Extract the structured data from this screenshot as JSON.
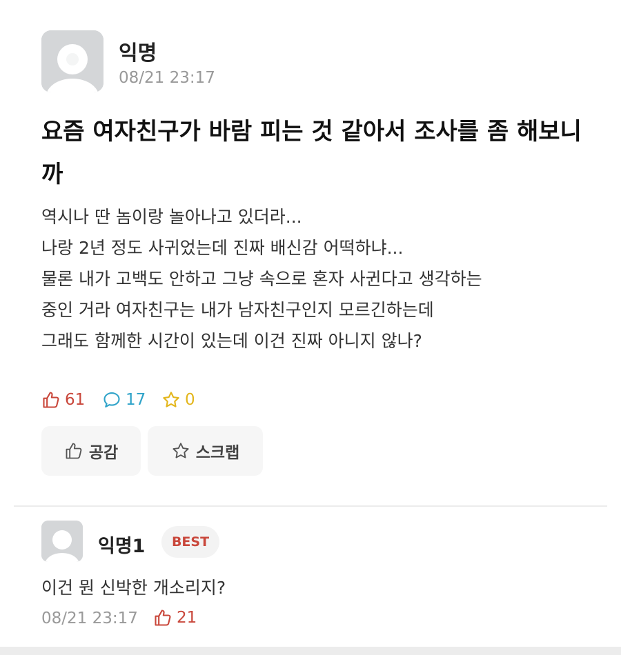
{
  "post": {
    "author": "익명",
    "timestamp": "08/21 23:17",
    "title": "요즘 여자친구가 바람 피는 것 같아서 조사를 좀 해보니까",
    "body_lines": [
      "역시나 딴 놈이랑 놀아나고 있더라...",
      "나랑 2년 정도 사귀었는데 진짜 배신감 어떡하냐...",
      "물론 내가 고백도 안하고 그냥 속으로 혼자 사귄다고 생각하는",
      "중인 거라 여자친구는 내가 남자친구인지 모르긴하는데",
      "그래도 함께한 시간이 있는데 이건 진짜 아니지 않나?"
    ],
    "stats": {
      "likes": "61",
      "comments": "17",
      "scraps": "0"
    },
    "actions": {
      "like_label": "공감",
      "scrap_label": "스크랩"
    }
  },
  "comment": {
    "author": "익명1",
    "badge": "BEST",
    "text": "이건 뭔 신박한 개소리지?",
    "timestamp": "08/21 23:17",
    "likes": "21"
  },
  "colors": {
    "like": "#c9473b",
    "comment": "#2fa3c9",
    "scrap": "#e3b61c",
    "muted": "#999999"
  },
  "icons": [
    "avatar-placeholder-icon",
    "thumbs-up-icon",
    "speech-bubble-icon",
    "star-icon"
  ]
}
